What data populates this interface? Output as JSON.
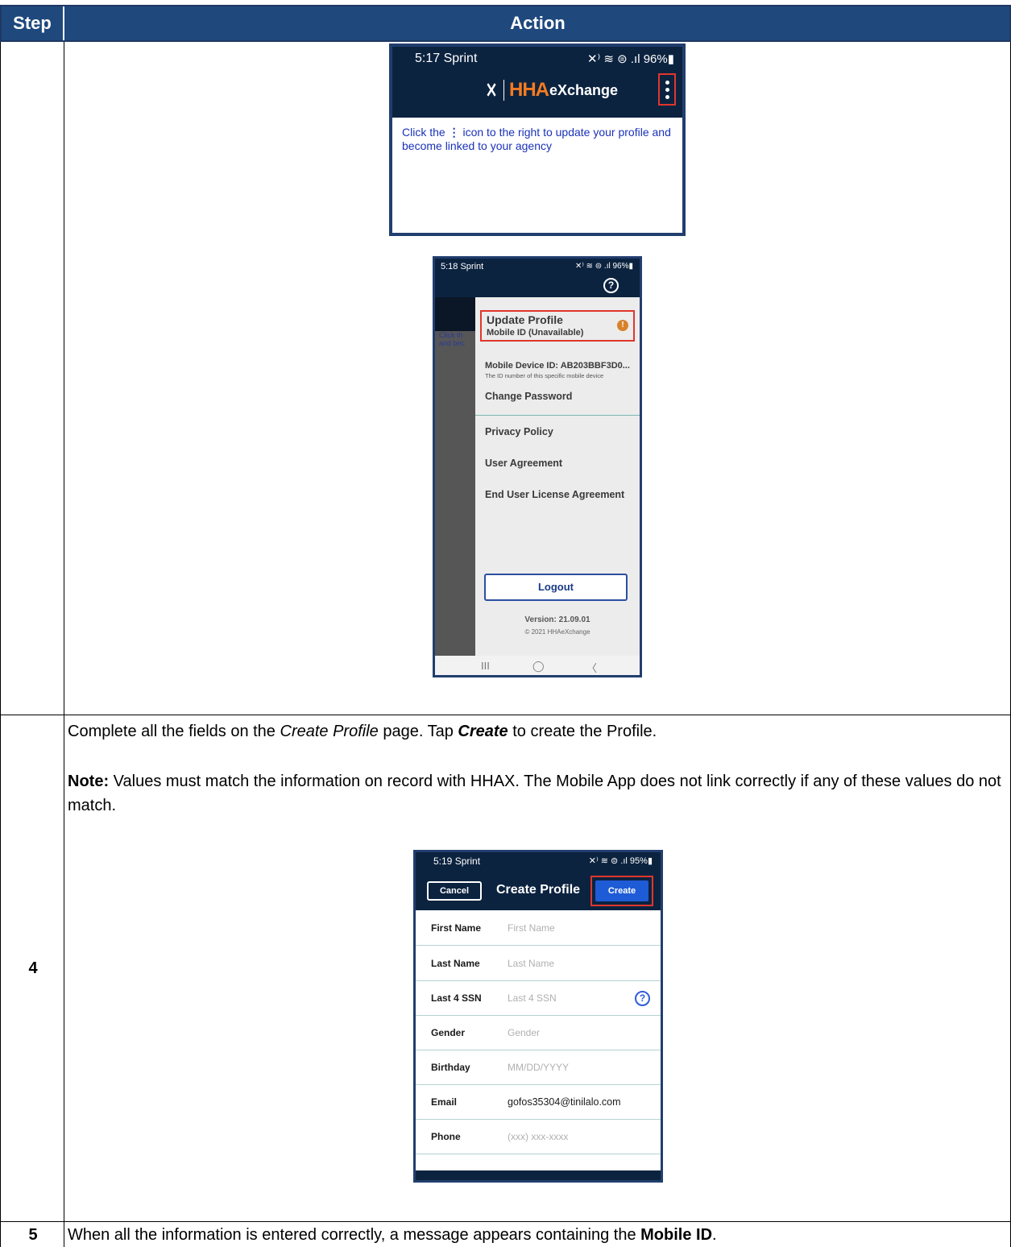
{
  "table": {
    "header_step": "Step",
    "header_action": "Action"
  },
  "phone1": {
    "status_time": "5:17 Sprint",
    "status_right": "✕⁾ ≋ ⊜ .ıl 96%▮",
    "logo_hha": "HHA",
    "logo_exchange": "eXchange",
    "message_part1": "Click the",
    "message_part2": "icon to the right to update your profile and become linked to your agency"
  },
  "phone2": {
    "status_time": "5:18 Sprint",
    "status_right": "✕⁾ ≋ ⊜ .ıl 96%▮",
    "help_glyph": "?",
    "peek_line1": "Click th",
    "peek_line2": "and bec",
    "update_profile": "Update Profile",
    "mobile_id": "Mobile ID (Unavailable)",
    "warn_glyph": "!",
    "mobile_device_id": "Mobile Device ID: AB203BBF3D0...",
    "mobile_device_sub": "The ID number of this specific mobile device",
    "change_password": "Change Password",
    "privacy_policy": "Privacy Policy",
    "user_agreement": "User Agreement",
    "eula": "End User License Agreement",
    "logout": "Logout",
    "version": "Version: 21.09.01",
    "copyright": "© 2021 HHAeXchange",
    "nav_recent": "III",
    "nav_home": "◯",
    "nav_back": "〈"
  },
  "step4": {
    "number": "4",
    "line1_a": "Complete all the fields on the ",
    "line1_b": "Create Profile",
    "line1_c": " page. Tap ",
    "line1_d": "Create",
    "line1_e": " to create the Profile.",
    "note_label": "Note:",
    "note_text": " Values must match the information on record with HHAX. The Mobile App does not link correctly if any of these values do not match."
  },
  "phone3": {
    "status_time": "5:19 Sprint",
    "status_right": "✕⁾ ≋ ⊜ .ıl 95%▮",
    "cancel": "Cancel",
    "title": "Create Profile",
    "create": "Create",
    "fields": [
      {
        "label": "First Name",
        "value": "First Name"
      },
      {
        "label": "Last Name",
        "value": "Last Name"
      },
      {
        "label": "Last 4 SSN",
        "value": "Last 4 SSN"
      },
      {
        "label": "Gender",
        "value": "Gender"
      },
      {
        "label": "Birthday",
        "value": "MM/DD/YYYY"
      },
      {
        "label": "Email",
        "value": "gofos35304@tinilalo.com"
      },
      {
        "label": "Phone",
        "value": "(xxx) xxx-xxxx"
      }
    ],
    "ssn_help": "?"
  },
  "step5": {
    "number": "5",
    "text_a": "When all the information is entered correctly, a message appears containing the ",
    "text_b": "Mobile ID",
    "text_c": "."
  }
}
